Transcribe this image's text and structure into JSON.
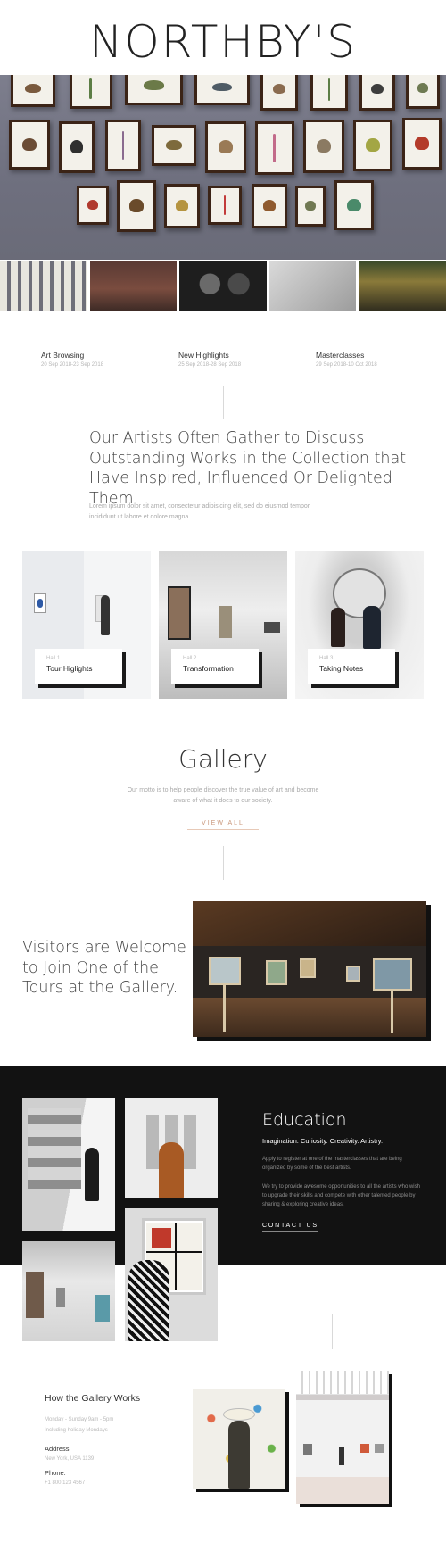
{
  "brand": {
    "logo": "NORTHBY'S"
  },
  "events": [
    {
      "title": "Art Browsing",
      "date": "20 Sep 2018-23 Sep 2018"
    },
    {
      "title": "New Highlights",
      "date": "25 Sep 2018-28 Sep 2018"
    },
    {
      "title": "Masterclasses",
      "date": "29 Sep 2018-10 Oct 2018"
    }
  ],
  "intro": {
    "headline": "Our Artists Often Gather to Discuss Outstanding Works in the Collection that Have Inspired, Influenced Or Delighted Them.",
    "body": "Lorem ipsum dolor sit amet, consectetur adipisicing elit, sed do eiusmod tempor incididunt ut labore et dolore magna."
  },
  "halls": [
    {
      "number": "Hall 1",
      "name": "Tour Higlights"
    },
    {
      "number": "Hall 2",
      "name": "Transformation"
    },
    {
      "number": "Hall 3",
      "name": "Taking Notes"
    }
  ],
  "gallery": {
    "title": "Gallery",
    "subtitle": "Our motto is to help people discover the true value of art and become aware of what it does to our society.",
    "view_all": "VIEW ALL"
  },
  "visitors": {
    "text": "Visitors are Welcome to Join One of the Tours at the Gallery."
  },
  "education": {
    "title": "Education",
    "tagline": "Imagination. Curiosity. Creativity. Artistry.",
    "p1": "Apply to register at one of the masterclasses that are being organized by some of the best artists.",
    "p2": "We try to provide awesome opportunities to all the artists who wish to upgrade their skills and compete with other talented people by sharing & exploring creative ideas.",
    "cta": "CONTACT US"
  },
  "how": {
    "title": "How the Gallery Works",
    "hours": "Monday - Sunday 9am - 5pm",
    "hours_note": "Including holiday Mondays",
    "address_label": "Address:",
    "address": "New York, USA 1139",
    "phone_label": "Phone:",
    "phone": "+1 800 123 4567"
  }
}
